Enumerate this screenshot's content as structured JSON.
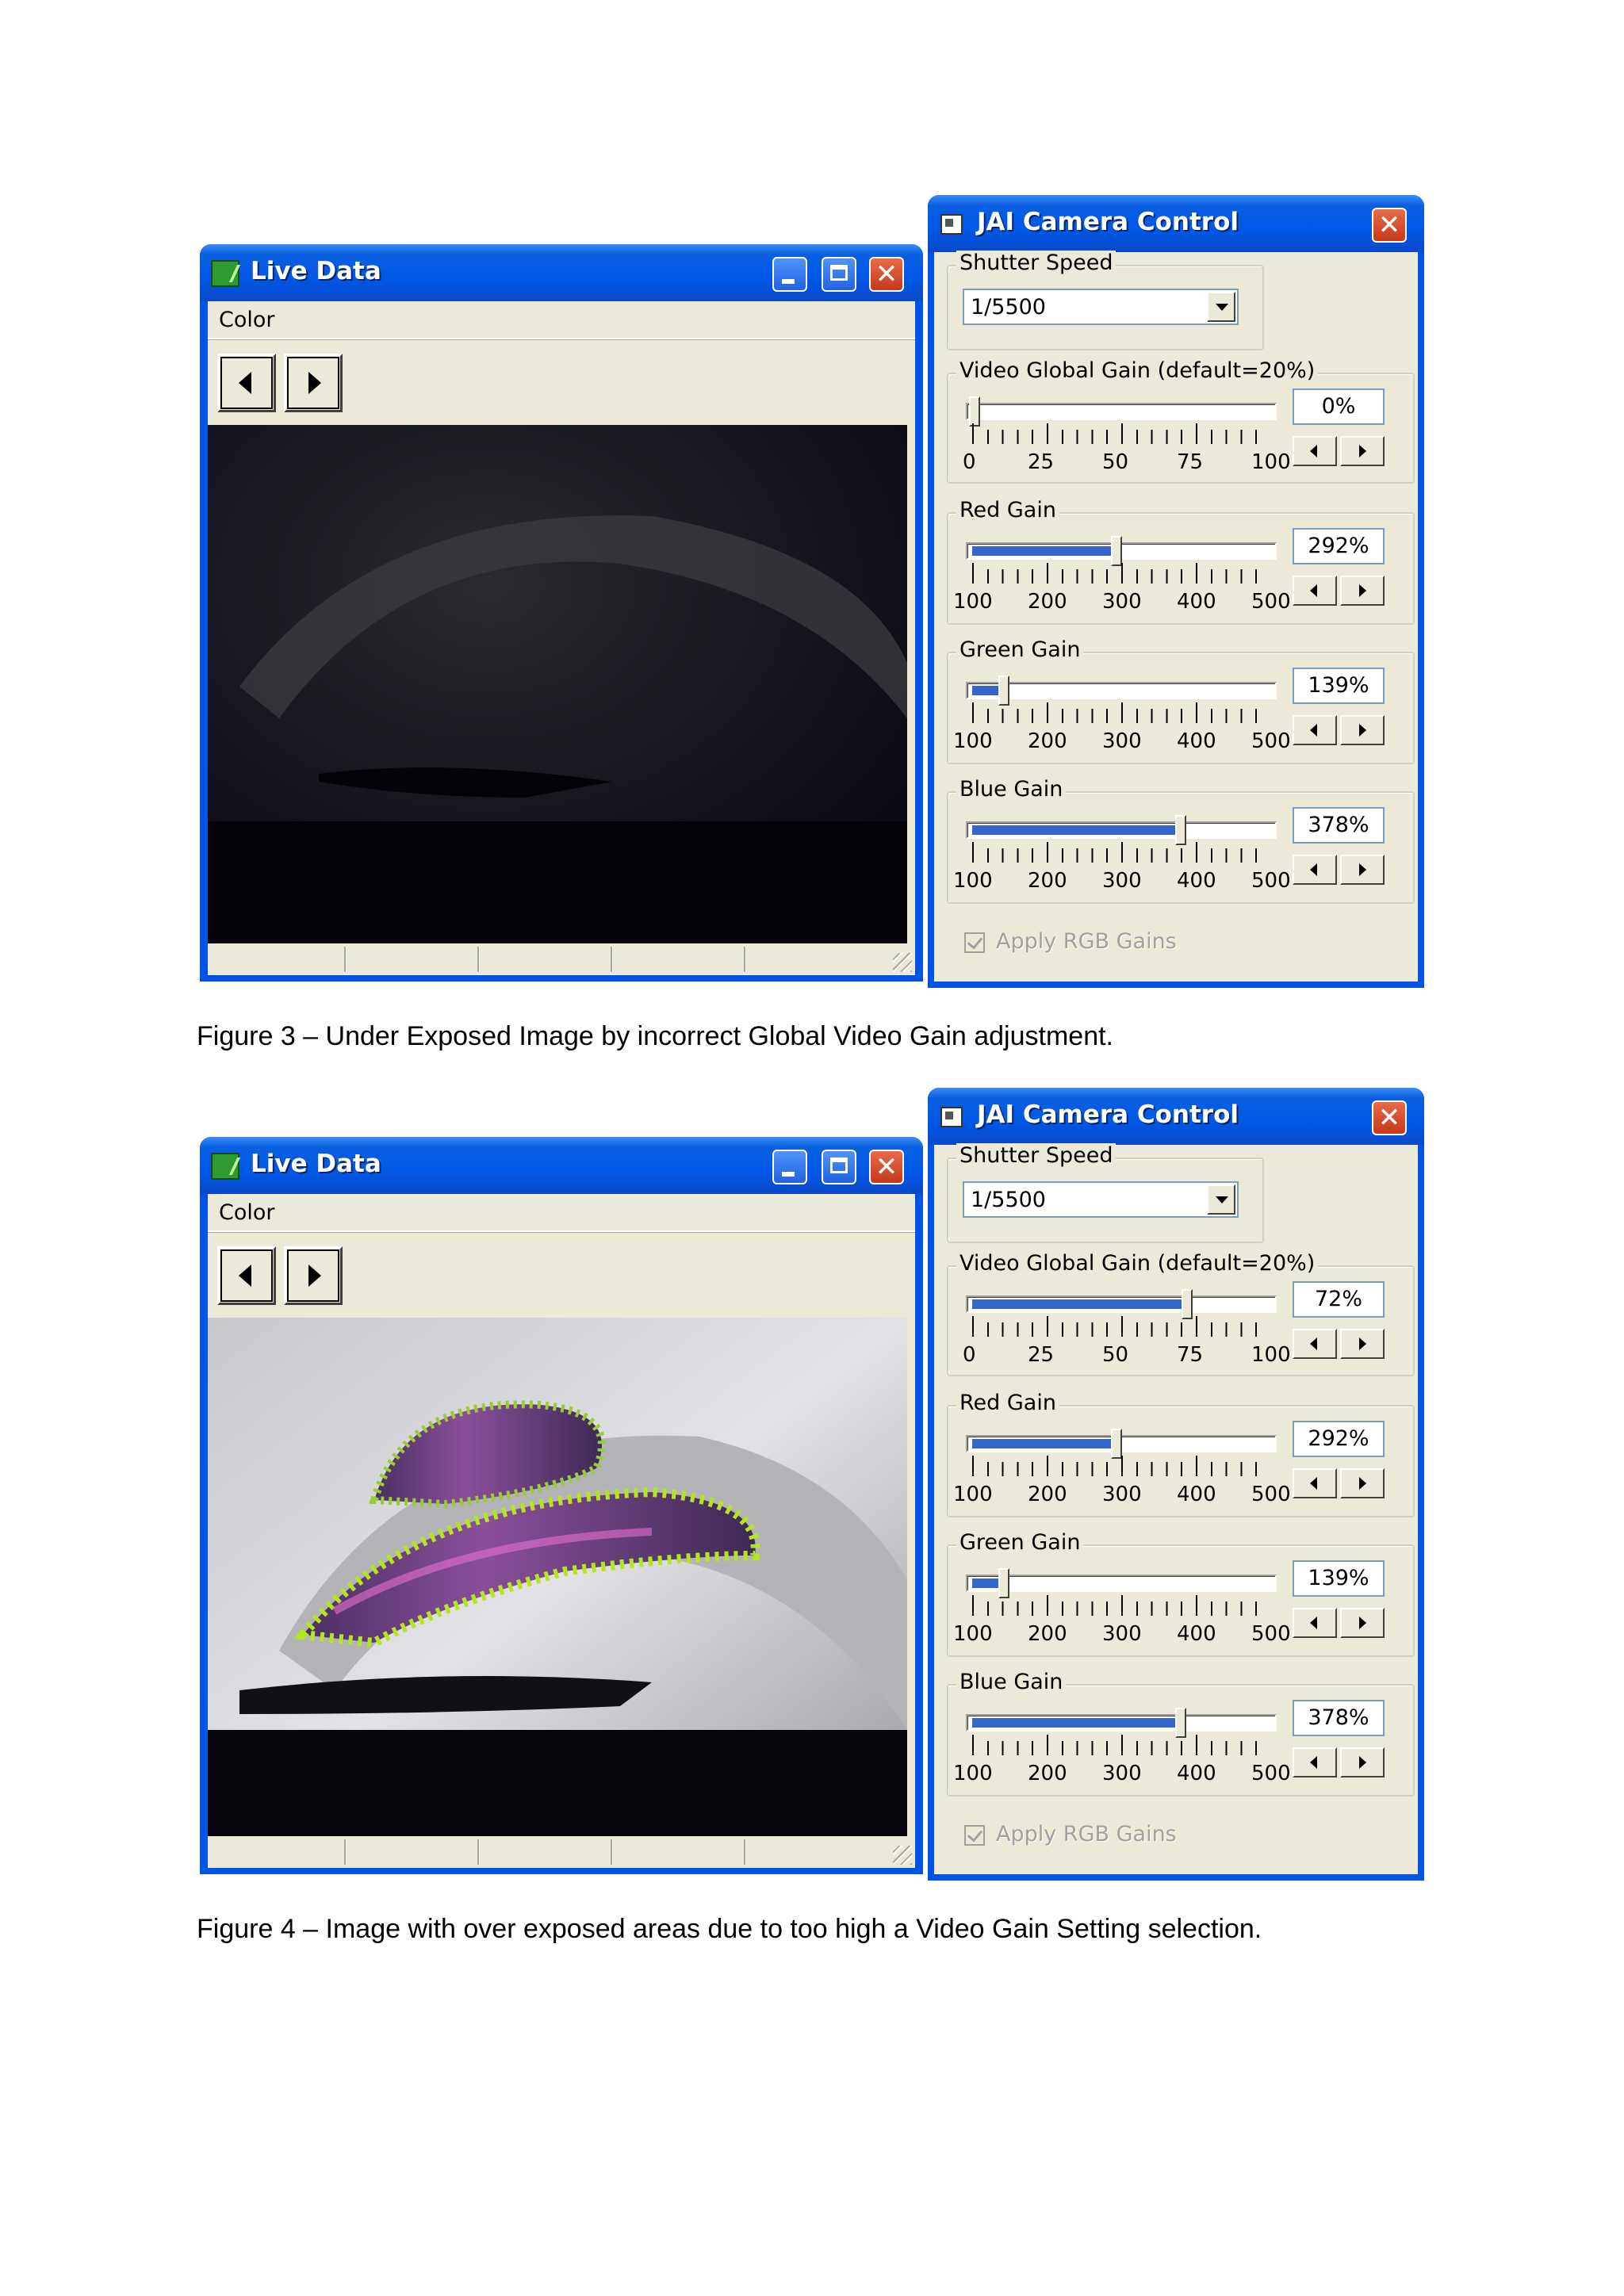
{
  "figure3": {
    "live_window": {
      "title": "Live Data",
      "menu": [
        "Color"
      ],
      "nav_prev_icon": "triangle-left",
      "nav_next_icon": "triangle-right",
      "video_state": "under-exposed"
    },
    "camera_window": {
      "title": "JAI Camera Control",
      "shutter_label": "Shutter Speed",
      "shutter_value": "1/5500",
      "video_gain": {
        "label": "Video Global Gain (default=20%)",
        "value": "0%",
        "fraction": 0.0,
        "scale": [
          "0",
          "25",
          "50",
          "75",
          "100"
        ]
      },
      "red_gain": {
        "label": "Red Gain",
        "value": "292%",
        "fraction": 0.48,
        "scale": [
          "100",
          "200",
          "300",
          "400",
          "500"
        ]
      },
      "green_gain": {
        "label": "Green Gain",
        "value": "139%",
        "fraction": 0.1,
        "scale": [
          "100",
          "200",
          "300",
          "400",
          "500"
        ]
      },
      "blue_gain": {
        "label": "Blue Gain",
        "value": "378%",
        "fraction": 0.7,
        "scale": [
          "100",
          "200",
          "300",
          "400",
          "500"
        ]
      },
      "apply_rgb": "Apply RGB Gains"
    },
    "caption": "Figure 3 – Under Exposed Image by incorrect Global Video Gain adjustment."
  },
  "figure4": {
    "live_window": {
      "title": "Live Data",
      "menu": [
        "Color"
      ],
      "nav_prev_icon": "triangle-left",
      "nav_next_icon": "triangle-right",
      "video_state": "over-exposed"
    },
    "camera_window": {
      "title": "JAI Camera Control",
      "shutter_label": "Shutter Speed",
      "shutter_value": "1/5500",
      "video_gain": {
        "label": "Video Global Gain (default=20%)",
        "value": "72%",
        "fraction": 0.72,
        "scale": [
          "0",
          "25",
          "50",
          "75",
          "100"
        ]
      },
      "red_gain": {
        "label": "Red Gain",
        "value": "292%",
        "fraction": 0.48,
        "scale": [
          "100",
          "200",
          "300",
          "400",
          "500"
        ]
      },
      "green_gain": {
        "label": "Green Gain",
        "value": "139%",
        "fraction": 0.1,
        "scale": [
          "100",
          "200",
          "300",
          "400",
          "500"
        ]
      },
      "blue_gain": {
        "label": "Blue Gain",
        "value": "378%",
        "fraction": 0.7,
        "scale": [
          "100",
          "200",
          "300",
          "400",
          "500"
        ]
      },
      "apply_rgb": "Apply RGB Gains"
    },
    "caption": "Figure 4 – Image with over exposed areas due to too high a Video Gain Setting selection."
  },
  "colors": {
    "xp_blue": "#0054e3",
    "face": "#ece9d8",
    "slider_fill": "#3366cc",
    "close_red": "#d9532e"
  }
}
